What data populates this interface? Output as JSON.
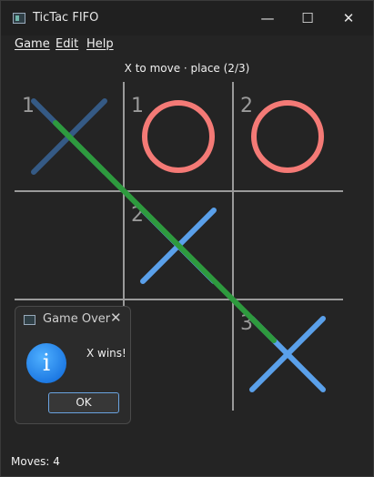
{
  "window": {
    "title": "TicTac FIFO",
    "controls": {
      "minimize": "—",
      "maximize": "☐",
      "close": "✕"
    }
  },
  "menu": {
    "game": "Game",
    "edit": "Edit",
    "help": "Help"
  },
  "status": {
    "turn": "X to move · place (2/3)",
    "moves": "Moves: 4"
  },
  "board": {
    "cells": [
      {
        "row": 0,
        "col": 0,
        "mark": "X",
        "order": "1",
        "faded": true
      },
      {
        "row": 0,
        "col": 1,
        "mark": "O",
        "order": "1"
      },
      {
        "row": 0,
        "col": 2,
        "mark": "O",
        "order": "2"
      },
      {
        "row": 1,
        "col": 1,
        "mark": "X",
        "order": "2"
      },
      {
        "row": 2,
        "col": 2,
        "mark": "X",
        "order": "3"
      }
    ],
    "winning_line": {
      "from": [
        0,
        0
      ],
      "to": [
        2,
        2
      ]
    },
    "colors": {
      "x": "#5aa0ea",
      "x_faded": "#355a85",
      "o": "#f47a76",
      "win": "#2e9a3e",
      "grid": "#9a9a9a"
    }
  },
  "dialog": {
    "title": "Game Over",
    "message": "X wins!",
    "ok_label": "OK",
    "icon": "info-icon",
    "close_glyph": "✕"
  }
}
